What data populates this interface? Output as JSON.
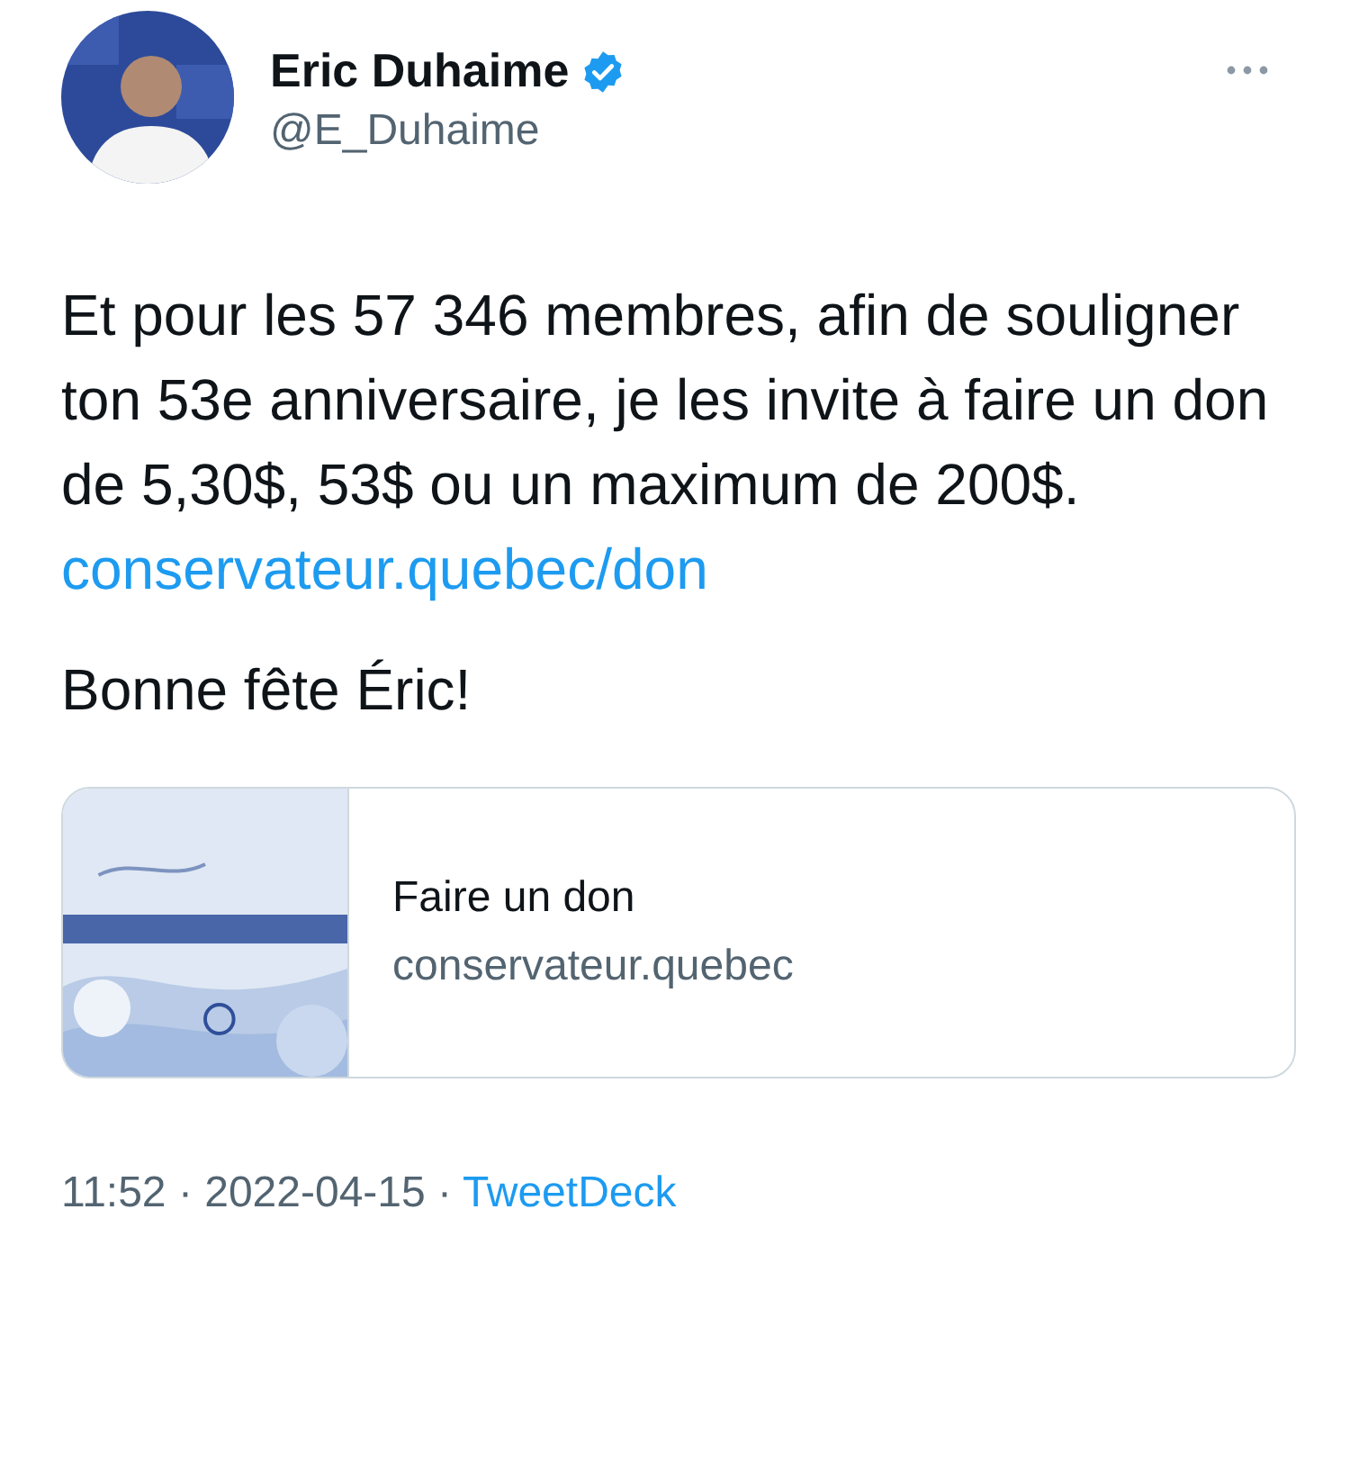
{
  "author": {
    "name": "Eric Duhaime",
    "handle": "@E_Duhaime",
    "verified": true
  },
  "text": "Et pour les 57 346 membres, afin de souligner ton 53e anniversaire, je les invite à faire un don de 5,30$, 53$ ou un maximum de 200$.",
  "link": "conservateur.quebec/don",
  "closing": "Bonne fête Éric!",
  "card": {
    "title": "Faire un don",
    "domain": "conservateur.quebec"
  },
  "meta": {
    "timestamp": "11:52 · 2022-04-15 ·",
    "source": "TweetDeck"
  }
}
